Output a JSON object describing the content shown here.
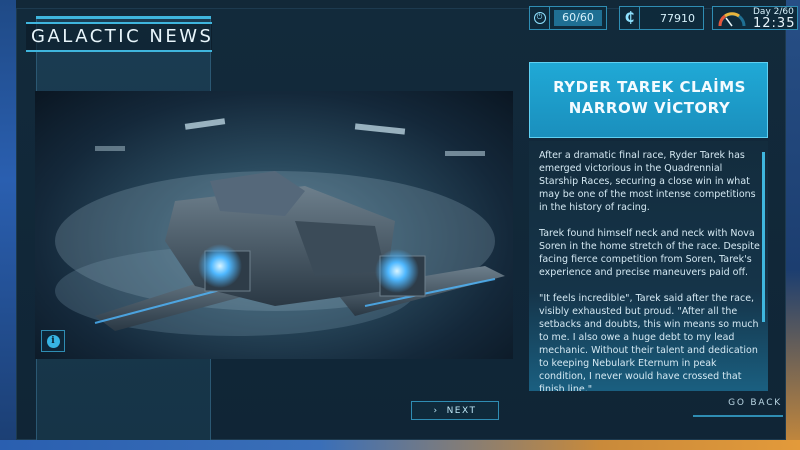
{
  "screen": {
    "title": "GALACTIC NEWS"
  },
  "hud": {
    "energy": "60/60",
    "credits_symbol": "₵",
    "credits": "77910",
    "day": "Day 2/60",
    "time": "12:35"
  },
  "article": {
    "headline_line1": "RYDER TAREK CLAİMS",
    "headline_line2": "NARROW VİCTORY",
    "paragraphs": [
      "After a dramatic final race, Ryder Tarek has emerged victorious in the Quadrennial Starship Races, securing a close win in what may be one of the most intense competitions in the history of racing.",
      "Tarek found himself neck and neck with Nova Soren in the home stretch of the race. Despite facing fierce competition from Soren, Tarek's experience and precise maneuvers paid off.",
      "\"It feels incredible\", Tarek said after the race, visibly exhausted but proud. \"After all the setbacks and doubts, this win means so much to me. I also owe a huge debt to my lead mechanic. Without their talent and dedication to keeping Nebulark Eternum in peak condition, I never would have crossed that finish line.\""
    ]
  },
  "buttons": {
    "next": "NEXT",
    "next_chevron": "›",
    "back": "GO BACK",
    "info": "i"
  },
  "colors": {
    "accent": "#3fb6de",
    "headline_bg": "#20a9d6"
  }
}
